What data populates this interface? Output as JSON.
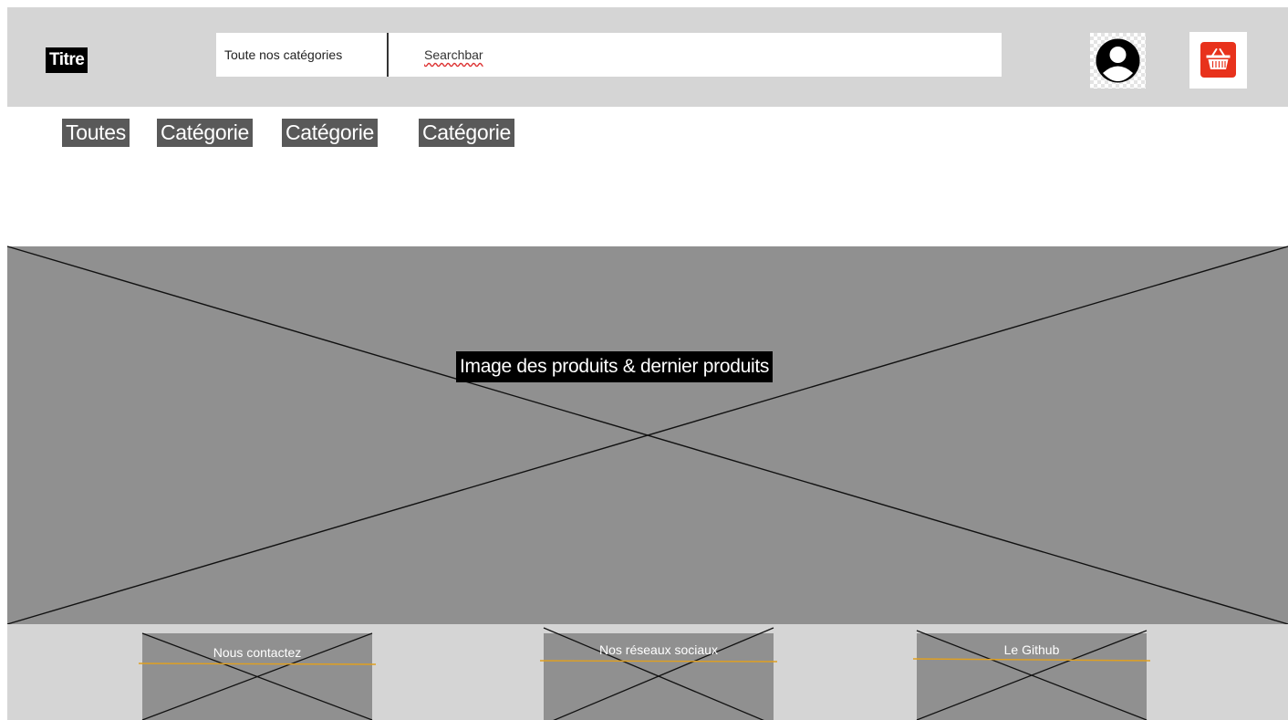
{
  "header": {
    "title": "Titre",
    "category_select": "Toute nos catégories",
    "search_placeholder": "Searchbar"
  },
  "header_icons": {
    "account": "user-account-icon",
    "cart": "shopping-basket-icon",
    "cart_color": "#e8321c"
  },
  "nav": {
    "items": [
      {
        "label": "Toutes"
      },
      {
        "label": "Catégorie"
      },
      {
        "label": "Catégorie"
      },
      {
        "label": "Catégorie"
      }
    ]
  },
  "hero": {
    "caption": "Image des produits & dernier produits"
  },
  "footer": {
    "links": [
      {
        "label": "Nous contactez"
      },
      {
        "label": "Nos réseaux sociaux"
      },
      {
        "label": "Le Github"
      }
    ],
    "accent_color": "#e0a020"
  }
}
